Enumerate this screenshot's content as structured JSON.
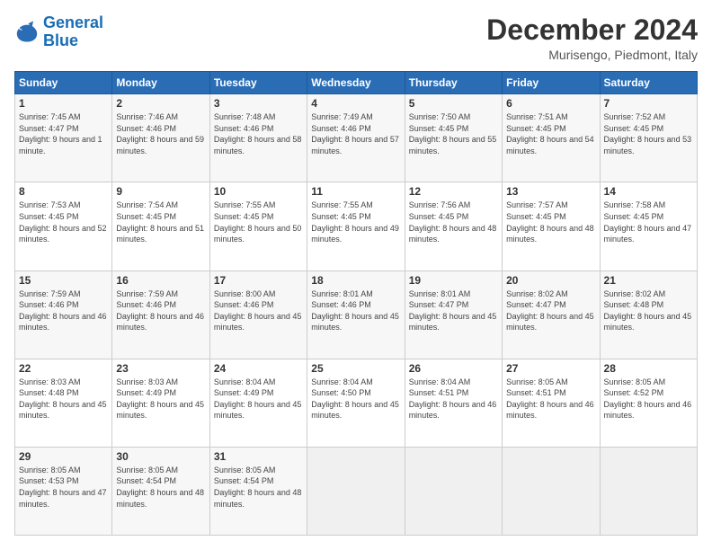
{
  "logo": {
    "line1": "General",
    "line2": "Blue"
  },
  "title": "December 2024",
  "location": "Murisengo, Piedmont, Italy",
  "days_of_week": [
    "Sunday",
    "Monday",
    "Tuesday",
    "Wednesday",
    "Thursday",
    "Friday",
    "Saturday"
  ],
  "weeks": [
    [
      {
        "day": "1",
        "sunrise": "7:45 AM",
        "sunset": "4:47 PM",
        "daylight": "9 hours and 1 minute."
      },
      {
        "day": "2",
        "sunrise": "7:46 AM",
        "sunset": "4:46 PM",
        "daylight": "8 hours and 59 minutes."
      },
      {
        "day": "3",
        "sunrise": "7:48 AM",
        "sunset": "4:46 PM",
        "daylight": "8 hours and 58 minutes."
      },
      {
        "day": "4",
        "sunrise": "7:49 AM",
        "sunset": "4:46 PM",
        "daylight": "8 hours and 57 minutes."
      },
      {
        "day": "5",
        "sunrise": "7:50 AM",
        "sunset": "4:45 PM",
        "daylight": "8 hours and 55 minutes."
      },
      {
        "day": "6",
        "sunrise": "7:51 AM",
        "sunset": "4:45 PM",
        "daylight": "8 hours and 54 minutes."
      },
      {
        "day": "7",
        "sunrise": "7:52 AM",
        "sunset": "4:45 PM",
        "daylight": "8 hours and 53 minutes."
      }
    ],
    [
      {
        "day": "8",
        "sunrise": "7:53 AM",
        "sunset": "4:45 PM",
        "daylight": "8 hours and 52 minutes."
      },
      {
        "day": "9",
        "sunrise": "7:54 AM",
        "sunset": "4:45 PM",
        "daylight": "8 hours and 51 minutes."
      },
      {
        "day": "10",
        "sunrise": "7:55 AM",
        "sunset": "4:45 PM",
        "daylight": "8 hours and 50 minutes."
      },
      {
        "day": "11",
        "sunrise": "7:55 AM",
        "sunset": "4:45 PM",
        "daylight": "8 hours and 49 minutes."
      },
      {
        "day": "12",
        "sunrise": "7:56 AM",
        "sunset": "4:45 PM",
        "daylight": "8 hours and 48 minutes."
      },
      {
        "day": "13",
        "sunrise": "7:57 AM",
        "sunset": "4:45 PM",
        "daylight": "8 hours and 48 minutes."
      },
      {
        "day": "14",
        "sunrise": "7:58 AM",
        "sunset": "4:45 PM",
        "daylight": "8 hours and 47 minutes."
      }
    ],
    [
      {
        "day": "15",
        "sunrise": "7:59 AM",
        "sunset": "4:46 PM",
        "daylight": "8 hours and 46 minutes."
      },
      {
        "day": "16",
        "sunrise": "7:59 AM",
        "sunset": "4:46 PM",
        "daylight": "8 hours and 46 minutes."
      },
      {
        "day": "17",
        "sunrise": "8:00 AM",
        "sunset": "4:46 PM",
        "daylight": "8 hours and 45 minutes."
      },
      {
        "day": "18",
        "sunrise": "8:01 AM",
        "sunset": "4:46 PM",
        "daylight": "8 hours and 45 minutes."
      },
      {
        "day": "19",
        "sunrise": "8:01 AM",
        "sunset": "4:47 PM",
        "daylight": "8 hours and 45 minutes."
      },
      {
        "day": "20",
        "sunrise": "8:02 AM",
        "sunset": "4:47 PM",
        "daylight": "8 hours and 45 minutes."
      },
      {
        "day": "21",
        "sunrise": "8:02 AM",
        "sunset": "4:48 PM",
        "daylight": "8 hours and 45 minutes."
      }
    ],
    [
      {
        "day": "22",
        "sunrise": "8:03 AM",
        "sunset": "4:48 PM",
        "daylight": "8 hours and 45 minutes."
      },
      {
        "day": "23",
        "sunrise": "8:03 AM",
        "sunset": "4:49 PM",
        "daylight": "8 hours and 45 minutes."
      },
      {
        "day": "24",
        "sunrise": "8:04 AM",
        "sunset": "4:49 PM",
        "daylight": "8 hours and 45 minutes."
      },
      {
        "day": "25",
        "sunrise": "8:04 AM",
        "sunset": "4:50 PM",
        "daylight": "8 hours and 45 minutes."
      },
      {
        "day": "26",
        "sunrise": "8:04 AM",
        "sunset": "4:51 PM",
        "daylight": "8 hours and 46 minutes."
      },
      {
        "day": "27",
        "sunrise": "8:05 AM",
        "sunset": "4:51 PM",
        "daylight": "8 hours and 46 minutes."
      },
      {
        "day": "28",
        "sunrise": "8:05 AM",
        "sunset": "4:52 PM",
        "daylight": "8 hours and 46 minutes."
      }
    ],
    [
      {
        "day": "29",
        "sunrise": "8:05 AM",
        "sunset": "4:53 PM",
        "daylight": "8 hours and 47 minutes."
      },
      {
        "day": "30",
        "sunrise": "8:05 AM",
        "sunset": "4:54 PM",
        "daylight": "8 hours and 48 minutes."
      },
      {
        "day": "31",
        "sunrise": "8:05 AM",
        "sunset": "4:54 PM",
        "daylight": "8 hours and 48 minutes."
      },
      null,
      null,
      null,
      null
    ]
  ]
}
